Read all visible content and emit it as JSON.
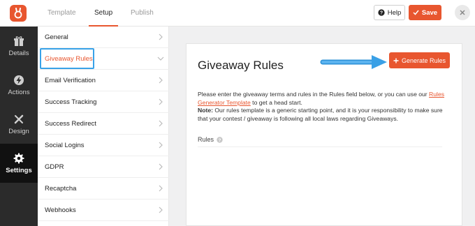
{
  "header": {
    "tabs": [
      {
        "label": "Template",
        "active": false
      },
      {
        "label": "Setup",
        "active": true
      },
      {
        "label": "Publish",
        "active": false
      }
    ],
    "help_label": "Help",
    "save_label": "Save"
  },
  "rail": {
    "items": [
      {
        "label": "Details",
        "icon": "gift-icon"
      },
      {
        "label": "Actions",
        "icon": "bolt-icon"
      },
      {
        "label": "Design",
        "icon": "brush-icon"
      },
      {
        "label": "Settings",
        "icon": "gear-icon",
        "active": true
      }
    ]
  },
  "menu": {
    "items": [
      {
        "label": "General"
      },
      {
        "label": "Giveaway Rules",
        "selected": true
      },
      {
        "label": "Email Verification"
      },
      {
        "label": "Success Tracking"
      },
      {
        "label": "Success Redirect"
      },
      {
        "label": "Social Logins"
      },
      {
        "label": "GDPR"
      },
      {
        "label": "Recaptcha"
      },
      {
        "label": "Webhooks"
      }
    ]
  },
  "main": {
    "title": "Giveaway Rules",
    "generate_label": "Generate Rules",
    "desc_part1": "Please enter the giveaway terms and rules in the Rules field below, or you can use our ",
    "desc_link": "Rules Generator Template",
    "desc_part2": " to get a head start.",
    "note_label": "Note:",
    "note_text": " Our rules template is a generic starting point, and it is your responsibility to make sure that your contest / giveaway is following all local laws regarding Giveaways.",
    "rules_label": "Rules"
  },
  "colors": {
    "accent": "#e8562f",
    "highlight": "#39a2e8",
    "rail_bg": "#2b2b2b"
  }
}
